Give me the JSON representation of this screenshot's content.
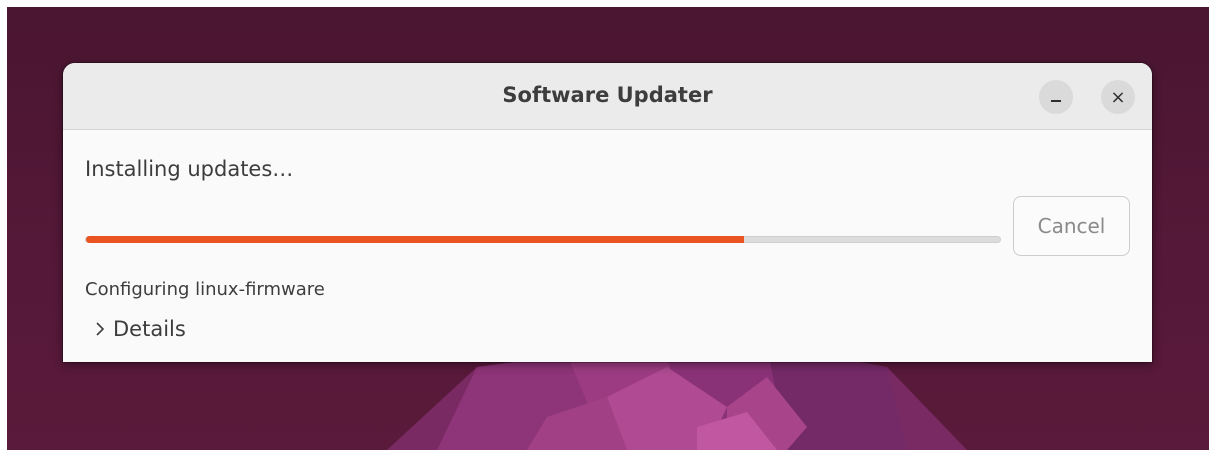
{
  "window": {
    "title": "Software Updater"
  },
  "titlebar_buttons": {
    "minimize_icon": "minimize-icon",
    "close_icon": "close-icon",
    "close_glyph": "×"
  },
  "progress": {
    "status": "Installing updates…",
    "fraction": 0.72,
    "substatus": "Configuring linux-firmware"
  },
  "actions": {
    "cancel_label": "Cancel"
  },
  "details": {
    "icon": "chevron-right-icon",
    "label": "Details"
  },
  "colors": {
    "accent": "#e95420",
    "desktop_bg": "#4e1734"
  }
}
